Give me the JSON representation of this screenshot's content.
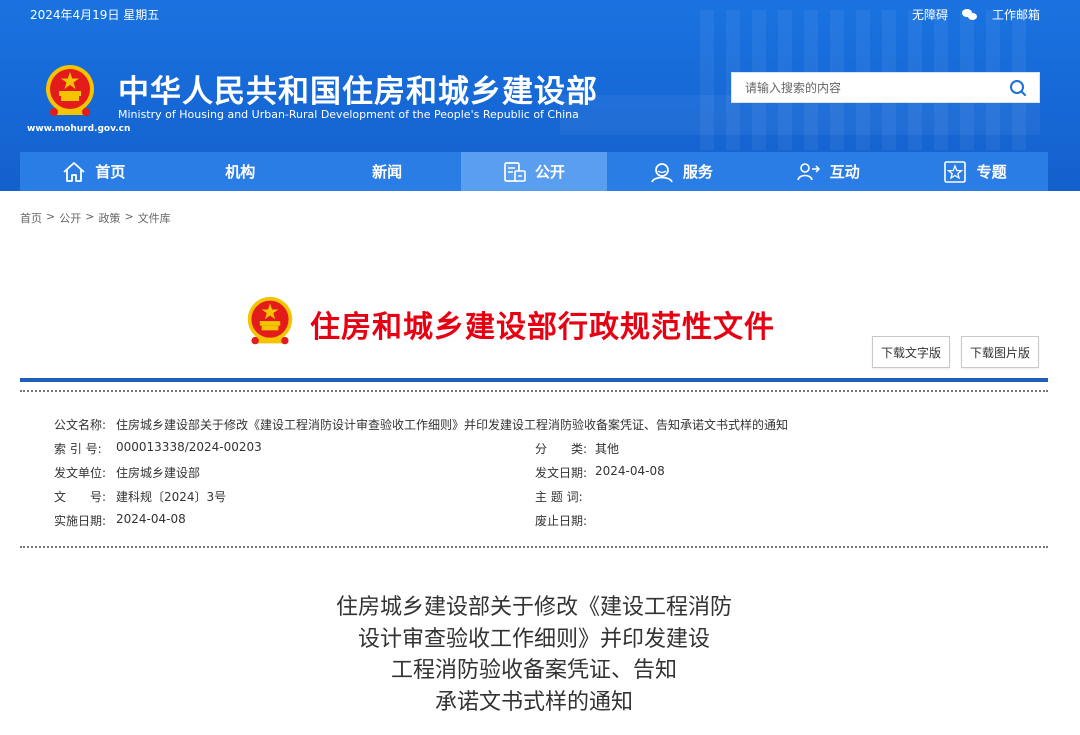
{
  "header": {
    "date": "2024年4月19日 星期五",
    "accessibility_label": "无障碍",
    "wechat_icon": "wechat-icon",
    "mail_label": "工作邮箱",
    "site_url": "www.mohurd.gov.cn",
    "site_title": "中华人民共和国住房和城乡建设部",
    "site_subtitle": "Ministry of Housing and Urban-Rural Development of the People's Republic of China",
    "search_placeholder": "请输入搜索的内容"
  },
  "nav": {
    "items": [
      {
        "label": "首页",
        "icon": "home-icon"
      },
      {
        "label": "机构",
        "icon": ""
      },
      {
        "label": "新闻",
        "icon": ""
      },
      {
        "label": "公开",
        "icon": "document-icon",
        "active": true
      },
      {
        "label": "服务",
        "icon": "service-icon"
      },
      {
        "label": "互动",
        "icon": "interaction-icon"
      },
      {
        "label": "专题",
        "icon": "star-icon"
      }
    ]
  },
  "breadcrumb": [
    "首页",
    "公开",
    "政策",
    "文件库"
  ],
  "banner": {
    "title": "住房和城乡建设部行政规范性文件",
    "download_text": "下载文字版",
    "download_image": "下载图片版"
  },
  "meta": {
    "doc_name_key": "公文名称:",
    "doc_name": "住房城乡建设部关于修改《建设工程消防设计审查验收工作细则》并印发建设工程消防验收备案凭证、告知承诺文书式样的通知",
    "index_key": "索 引 号:",
    "index": "000013338/2024-00203",
    "category_key": "分　　类:",
    "category": "其他",
    "issuer_key": "发文单位:",
    "issuer": "住房城乡建设部",
    "issue_date_key": "发文日期:",
    "issue_date": "2024-04-08",
    "doc_no_key": "文　　号:",
    "doc_no": "建科规〔2024〕3号",
    "subject_key": "主 题 词:",
    "subject": "",
    "effective_key": "实施日期:",
    "effective": "2024-04-08",
    "abolish_key": "废止日期:",
    "abolish": ""
  },
  "title_lines": [
    "住房城乡建设部关于修改《建设工程消防",
    "设计审查验收工作细则》并印发建设",
    "工程消防验收备案凭证、告知",
    "承诺文书式样的通知"
  ],
  "colors": {
    "header_blue": "#1a73e0",
    "nav_blue": "#2b7de6",
    "nav_active": "#5a9fef",
    "banner_red": "#e60012",
    "rule_blue": "#1f5fb8"
  }
}
